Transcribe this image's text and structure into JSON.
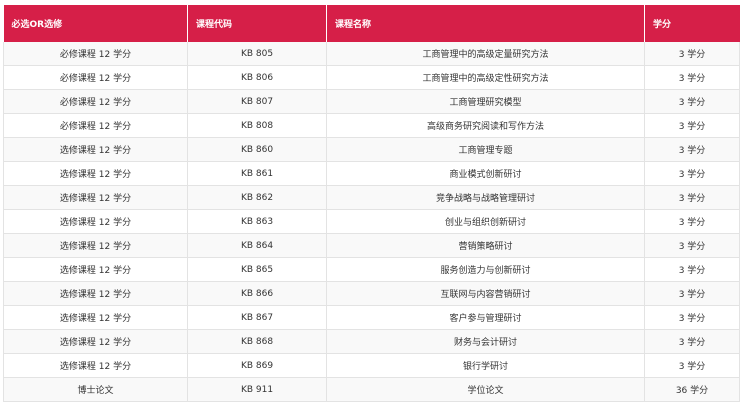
{
  "table": {
    "headers": [
      "必选OR选修",
      "课程代码",
      "课程名称",
      "学分"
    ],
    "rows": [
      [
        "必修课程 12 学分",
        "KB 805",
        "工商管理中的高级定量研究方法",
        "3 学分"
      ],
      [
        "必修课程 12 学分",
        "KB 806",
        "工商管理中的高级定性研究方法",
        "3 学分"
      ],
      [
        "必修课程 12 学分",
        "KB 807",
        "工商管理研究模型",
        "3 学分"
      ],
      [
        "必修课程 12 学分",
        "KB 808",
        "高级商务研究阅读和写作方法",
        "3 学分"
      ],
      [
        "选修课程 12 学分",
        "KB 860",
        "工商管理专题",
        "3 学分"
      ],
      [
        "选修课程 12 学分",
        "KB 861",
        "商业模式创新研讨",
        "3 学分"
      ],
      [
        "选修课程 12 学分",
        "KB 862",
        "竞争战略与战略管理研讨",
        "3 学分"
      ],
      [
        "选修课程 12 学分",
        "KB 863",
        "创业与组织创新研讨",
        "3 学分"
      ],
      [
        "选修课程 12 学分",
        "KB 864",
        "营销策略研讨",
        "3 学分"
      ],
      [
        "选修课程 12 学分",
        "KB 865",
        "服务创造力与创新研讨",
        "3 学分"
      ],
      [
        "选修课程 12 学分",
        "KB 866",
        "互联网与内容营销研讨",
        "3 学分"
      ],
      [
        "选修课程 12 学分",
        "KB 867",
        "客户参与管理研讨",
        "3 学分"
      ],
      [
        "选修课程 12 学分",
        "KB 868",
        "财务与会计研讨",
        "3 学分"
      ],
      [
        "选修课程 12 学分",
        "KB 869",
        "银行学研讨",
        "3 学分"
      ],
      [
        "博士论文",
        "KB 911",
        "学位论文",
        "36 学分"
      ]
    ]
  },
  "colors": {
    "header_bg": "#d61f48",
    "header_text": "#ffffff",
    "row_alt": "#f9f9f9",
    "border": "#e3e3e3"
  }
}
